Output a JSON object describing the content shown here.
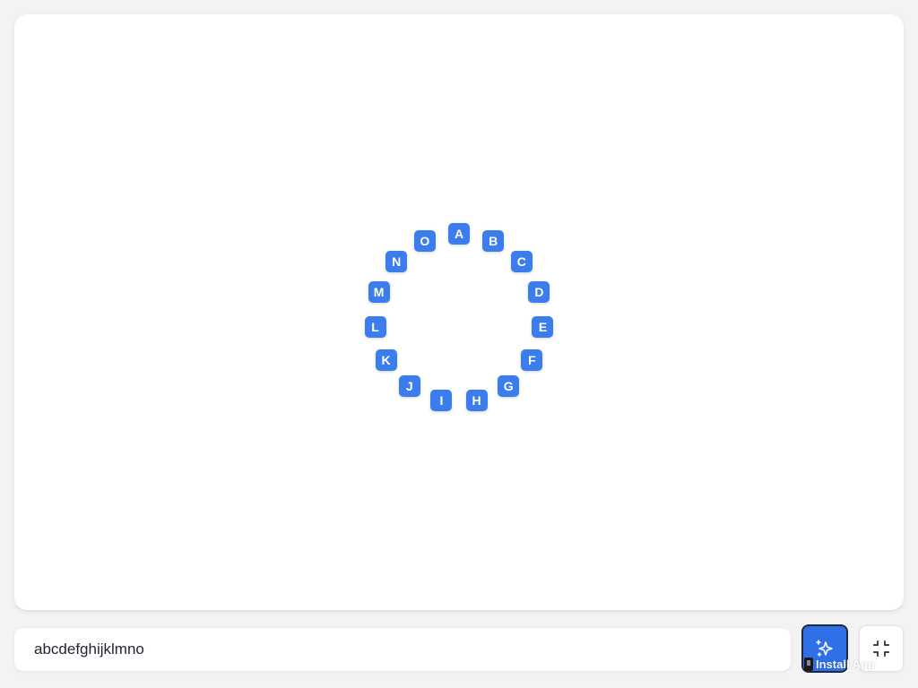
{
  "ring": {
    "letters": [
      "A",
      "B",
      "C",
      "D",
      "E",
      "F",
      "G",
      "H",
      "I",
      "J",
      "K",
      "L",
      "M",
      "N",
      "O"
    ],
    "color": "#3b7ded"
  },
  "input": {
    "value": "abcdefghijklmno"
  },
  "buttons": {
    "magic": {
      "icon": "sparkles-icon",
      "color": "#2f6fe8"
    },
    "collapse": {
      "icon": "collapse-icon"
    }
  },
  "install_badge": {
    "label": "Install App"
  }
}
